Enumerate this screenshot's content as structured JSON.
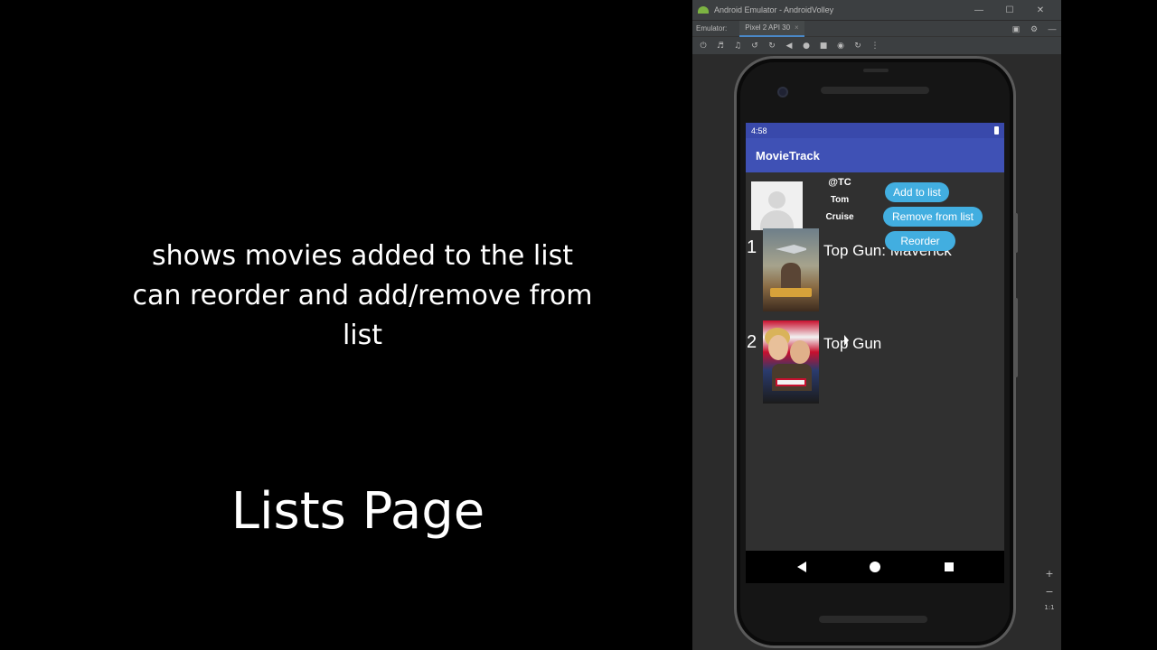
{
  "caption": {
    "line1": "shows movies added to the list",
    "line2": "can reorder and add/remove from",
    "line3": "list"
  },
  "page_title": "Lists Page",
  "emulator": {
    "window_title": "Android Emulator - AndroidVolley",
    "tab_prefix": "Emulator:",
    "device_tab": "Pixel 2 API 30",
    "close_glyph": "×",
    "minimize_glyph": "—",
    "maximize_glyph": "☐",
    "window_close_glyph": "✕",
    "zoom_in": "+",
    "zoom_out": "−",
    "zoom_ratio": "1:1"
  },
  "app": {
    "status_time": "4:58",
    "app_title": "MovieTrack",
    "profile": {
      "handle": "@TC",
      "first_name": "Tom",
      "last_name": "Cruise"
    },
    "buttons": {
      "add": "Add to list",
      "remove": "Remove from list",
      "reorder": "Reorder"
    },
    "movies": [
      {
        "rank": "1",
        "title": "Top Gun: Maverick"
      },
      {
        "rank": "2",
        "title": "Top Gun"
      }
    ]
  }
}
